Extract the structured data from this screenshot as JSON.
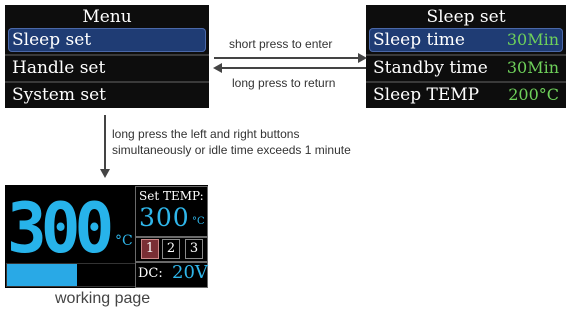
{
  "menu": {
    "title": "Menu",
    "items": [
      {
        "label": "Sleep set",
        "selected": true
      },
      {
        "label": "Handle set",
        "selected": false
      },
      {
        "label": "System set",
        "selected": false
      }
    ]
  },
  "sleep_set": {
    "title": "Sleep set",
    "rows": [
      {
        "label": "Sleep time",
        "value": "30Min",
        "selected": true
      },
      {
        "label": "Standby time",
        "value": "30Min",
        "selected": false
      },
      {
        "label": "Sleep TEMP",
        "value": "200°C",
        "selected": false
      }
    ]
  },
  "arrows": {
    "enter_label": "short press to enter",
    "return_label": "long press to return",
    "down_label_line1": "long press the left and right buttons",
    "down_label_line2": "simultaneously or idle time exceeds 1 minute"
  },
  "working_page": {
    "temperature": "300",
    "temp_unit": "°C",
    "set_temp_label": "Set TEMP:",
    "set_temp_value": "300",
    "set_temp_unit": "°C",
    "modes": [
      "1",
      "2",
      "3"
    ],
    "active_mode": "1",
    "power_bar_fraction": 0.55,
    "dc_label": "DC:",
    "dc_value": "20V",
    "caption": "working page"
  },
  "colors": {
    "lcd_background": "#0d0d0d",
    "selection": "#1f3c74",
    "value_green": "#6ed05a",
    "temp_cyan": "#27b3ea",
    "active_mode": "#7a2f35"
  }
}
